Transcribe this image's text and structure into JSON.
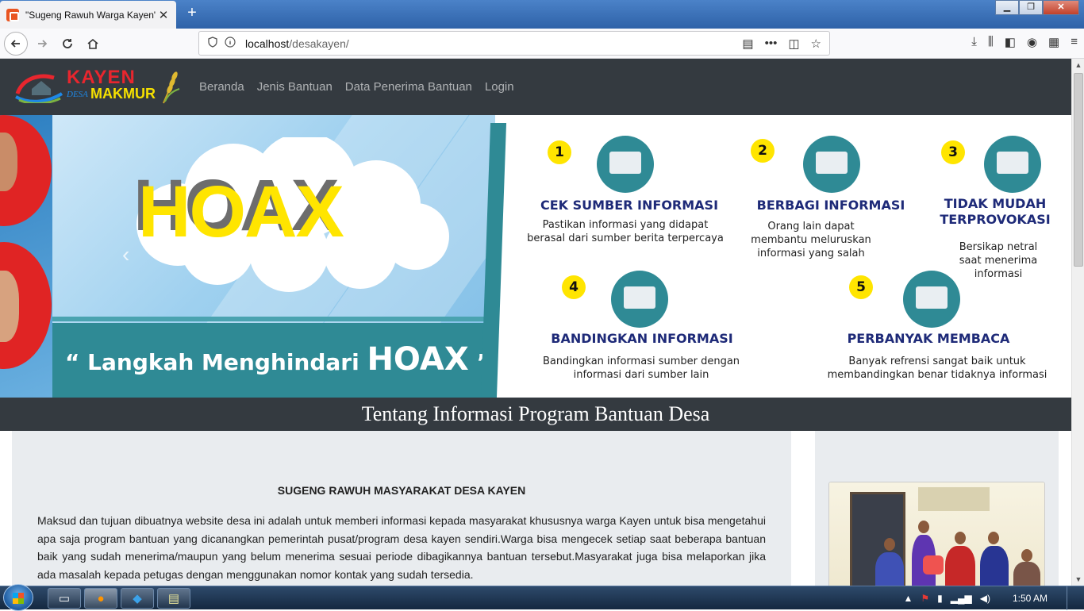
{
  "browser": {
    "tab_title": "\"Sugeng Rawuh Warga Kayen\"",
    "tab_close": "✕",
    "new_tab": "+",
    "url_host": "localhost",
    "url_path": "/desakayen/",
    "window_controls": {
      "minimize": "▁",
      "maximize": "❐",
      "close": "✕"
    }
  },
  "site": {
    "logo": {
      "top": "KAYEN",
      "desa": "DESA",
      "bottom": "MAKMUR"
    },
    "menu": [
      "Beranda",
      "Jenis Bantuan",
      "Data Penerima Bantuan",
      "Login"
    ]
  },
  "banner": {
    "hoax_word": "HOAX",
    "slogan_prefix": "“ Langkah Menghindari ",
    "slogan_hoax": "HOAX",
    "slogan_suffix": " ”",
    "prev_control": "‹",
    "steps": [
      {
        "num": "1",
        "title": "CEK SUMBER INFORMASI",
        "desc": "Pastikan informasi yang didapat berasal dari sumber berita terpercaya"
      },
      {
        "num": "2",
        "title": "BERBAGI INFORMASI",
        "desc": "Orang lain dapat membantu meluruskan informasi yang salah"
      },
      {
        "num": "3",
        "title": "TIDAK MUDAH TERPROVOKASI",
        "desc": "Bersikap netral saat menerima informasi"
      },
      {
        "num": "4",
        "title": "BANDINGKAN INFORMASI",
        "desc": "Bandingkan informasi sumber dengan informasi dari sumber lain"
      },
      {
        "num": "5",
        "title": "PERBANYAK MEMBACA",
        "desc": "Banyak refrensi sangat baik untuk membandingkan benar tidaknya informasi"
      }
    ]
  },
  "section": {
    "title": "Tentang Informasi Program Bantuan Desa"
  },
  "main": {
    "heading": "SUGENG RAWUH MASYARAKAT DESA KAYEN",
    "text": "Maksud dan tujuan dibuatnya website desa ini adalah untuk memberi informasi kepada masyarakat khususnya warga Kayen untuk bisa mengetahui apa saja program bantuan yang dicanangkan pemerintah pusat/program desa kayen sendiri.Warga bisa mengecek setiap saat beberapa bantuan baik yang sudah menerima/maupun yang belum menerima sesuai periode dibagikannya bantuan tersebut.Masyarakat juga bisa melaporkan jika ada masalah kepada petugas dengan menggunakan nomor kontak yang sudah tersedia."
  },
  "taskbar": {
    "clock": "1:50 AM",
    "tray_arrow": "▲"
  },
  "colors": {
    "navbar": "#343a40",
    "card": "#e9ecef",
    "teal": "#2f8a95",
    "hoax_yellow": "#ffe500",
    "step_title": "#1e2a78"
  }
}
